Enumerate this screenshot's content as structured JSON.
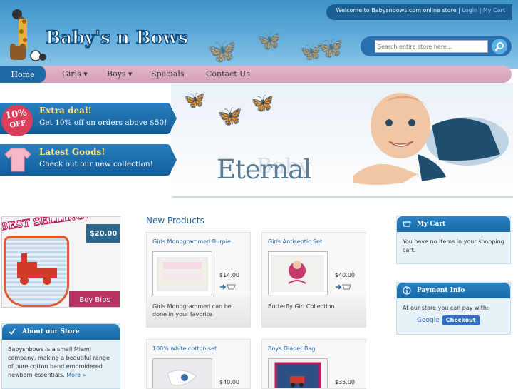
{
  "header": {
    "welcome_text": "Welcome to Babysnbows.com online store |",
    "login_link": "Login",
    "separator": "|",
    "cart_link": "My Cart",
    "logo_text": "Baby's n Bows",
    "search_placeholder": "Search entire store here..."
  },
  "nav": {
    "items": [
      {
        "label": "Home"
      },
      {
        "label": "Girls ▾"
      },
      {
        "label": "Boys ▾"
      },
      {
        "label": "Specials"
      },
      {
        "label": "Contact Us"
      }
    ]
  },
  "promos": [
    {
      "badge_top": "10%",
      "badge_bottom": "OFF",
      "title": "Extra deal!",
      "text": "Get 10% off on orders above $50!"
    },
    {
      "title": "Latest Goods!",
      "text": "Check out our new collection!"
    }
  ],
  "hero": {
    "headline": "Eternal",
    "headline_shadow": "Baby"
  },
  "bestselling": {
    "label": "BEST SELLING!",
    "price": "$20.00",
    "name": "Boy Bibs"
  },
  "about": {
    "title": "About our Store",
    "text": "Babysnbows is a small Miami company, making a beautiful range of pure cotton hand embroidered newborn essentials.",
    "more": "More »"
  },
  "new_products": {
    "title": "New Products",
    "items": [
      {
        "name": "Girls Monogrammed Burpie",
        "price": "$14.00",
        "desc": "Girls Monogrammed can be done in your favorite"
      },
      {
        "name": "Girls Antiseptic Set",
        "price": "$40.00",
        "desc": "Butterfly Girl Collection"
      },
      {
        "name": "100% white cotton set",
        "price": "$40.00",
        "desc": ""
      },
      {
        "name": "Boys Diaper Bag",
        "price": "$35.00",
        "desc": ""
      }
    ]
  },
  "cart": {
    "title": "My Cart",
    "text": "You have no items in your shopping cart."
  },
  "payment": {
    "title": "Payment Info",
    "text": "At our store you can pay with:",
    "google": "Google",
    "checkout": "Checkout"
  },
  "colors": {
    "header_blue": "#3f93c9",
    "nav_pink": "#d9a6bd",
    "accent_blue": "#1f6aa6",
    "link_blue": "#1e63a8"
  }
}
